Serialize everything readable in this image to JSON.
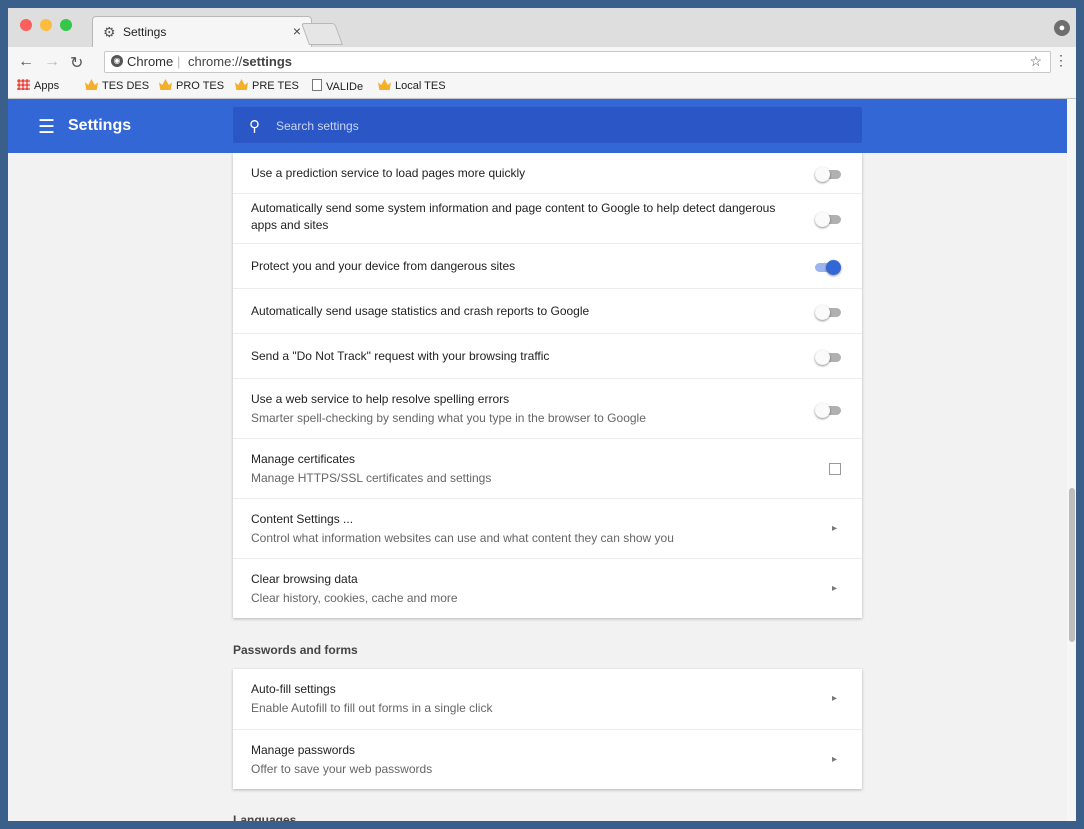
{
  "tab": {
    "title": "Settings"
  },
  "omnibox": {
    "scheme": "Chrome",
    "url_prefix": "chrome://",
    "url_bold": "settings"
  },
  "bookmarks": [
    {
      "label": "Apps",
      "icon": "apps-grid-icon"
    },
    {
      "label": "TES DES",
      "icon": "crown-icon"
    },
    {
      "label": "PRO TES",
      "icon": "crown-icon"
    },
    {
      "label": "PRE TES",
      "icon": "crown-icon"
    },
    {
      "label": "VALIDe",
      "icon": "page-icon"
    },
    {
      "label": "Local TES",
      "icon": "crown-icon"
    }
  ],
  "header": {
    "title": "Settings",
    "search_placeholder": "Search settings"
  },
  "privacy_rows": [
    {
      "title": "Use a prediction service to load pages more quickly",
      "control": "toggle",
      "on": false
    },
    {
      "title": "Automatically send some system information and page content to Google to help detect dangerous apps and sites",
      "control": "toggle",
      "on": false
    },
    {
      "title": "Protect you and your device from dangerous sites",
      "control": "toggle",
      "on": true
    },
    {
      "title": "Automatically send usage statistics and crash reports to Google",
      "control": "toggle",
      "on": false
    },
    {
      "title": "Send a \"Do Not Track\" request with your browsing traffic",
      "control": "toggle",
      "on": false
    },
    {
      "title": "Use a web service to help resolve spelling errors",
      "subtitle": "Smarter spell-checking by sending what you type in the browser to Google",
      "control": "toggle",
      "on": false
    },
    {
      "title": "Manage certificates",
      "subtitle": "Manage HTTPS/SSL certificates and settings",
      "control": "external-link"
    },
    {
      "title": "Content Settings ...",
      "subtitle": "Control what information websites can use and what content they can show you",
      "control": "arrow"
    },
    {
      "title": "Clear browsing data",
      "subtitle": "Clear history, cookies, cache and more",
      "control": "arrow"
    }
  ],
  "passwords_section": {
    "title": "Passwords and forms",
    "rows": [
      {
        "title": "Auto-fill settings",
        "subtitle": "Enable Autofill to fill out forms in a single click",
        "control": "arrow"
      },
      {
        "title": "Manage passwords",
        "subtitle": "Offer to save your web passwords",
        "control": "arrow"
      }
    ]
  },
  "languages_section": {
    "title": "Languages"
  },
  "colors": {
    "accent": "#3367d6",
    "search_bg": "#2a56c6",
    "toggle_on": "#3367d6",
    "toggle_off": "#b0b0b0"
  }
}
